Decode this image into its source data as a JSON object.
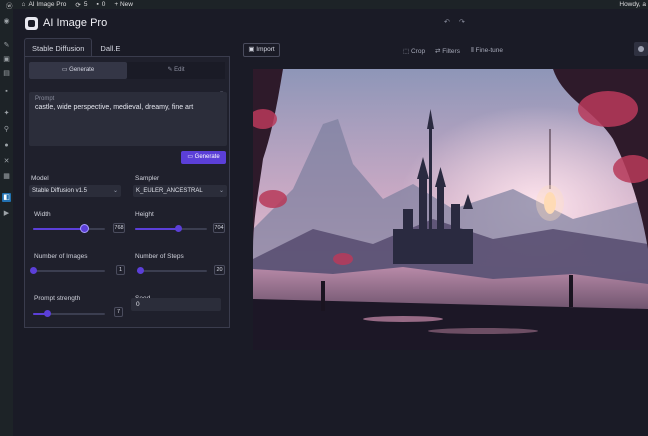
{
  "admin_bar": {
    "site_name": "AI Image Pro",
    "updates_count": "5",
    "comments_count": "0",
    "new_label": "+ New",
    "howdy": "Howdy, a"
  },
  "app": {
    "title": "AI Image Pro",
    "tabs": [
      {
        "label": "Stable Diffusion",
        "active": true
      },
      {
        "label": "Dall.E",
        "active": false
      }
    ],
    "mode": {
      "generate_label": "Generate",
      "edit_label": "Edit"
    },
    "prompt": {
      "label": "Prompt",
      "value": "castle, wide perspective, medieval, dreamy, fine art"
    },
    "generate_button": "Generate",
    "model": {
      "label": "Model",
      "value": "Stable Diffusion v1.5"
    },
    "sampler": {
      "label": "Sampler",
      "value": "K_EULER_ANCESTRAL"
    },
    "width": {
      "label": "Width",
      "value": "768",
      "fraction": 0.72
    },
    "height": {
      "label": "Height",
      "value": "704",
      "fraction": 0.6
    },
    "num_images": {
      "label": "Number of Images",
      "value": "1",
      "fraction": 0.0
    },
    "num_steps": {
      "label": "Number of Steps",
      "value": "20",
      "fraction": 0.05
    },
    "prompt_strength": {
      "label": "Prompt strength",
      "value": "7",
      "fraction": 0.2
    },
    "seed": {
      "label": "Seed",
      "value": "0"
    }
  },
  "toolbar": {
    "import_label": "Import",
    "crop_label": "Crop",
    "filters_label": "Filters",
    "finetune_label": "Fine-tune"
  },
  "colors": {
    "accent": "#5b3fd8",
    "background": "#1a1b26",
    "panel": "#1f202c",
    "admin_bar": "#1d2327"
  }
}
